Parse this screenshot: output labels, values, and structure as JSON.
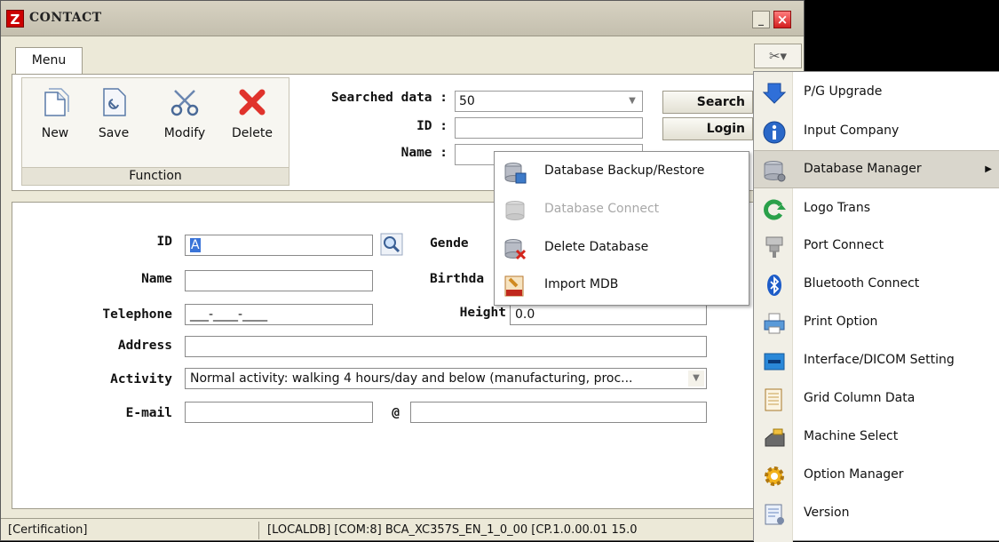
{
  "window": {
    "title": "CONTACT",
    "logo_letter": "Z",
    "minimize": "_",
    "close": "×"
  },
  "tabs": {
    "menu": "Menu",
    "tools_icon": "✂▾"
  },
  "ribbon": {
    "buttons": [
      {
        "label": "New",
        "icon": "new-document-icon"
      },
      {
        "label": "Save",
        "icon": "save-icon"
      },
      {
        "label": "Modify",
        "icon": "scissors-icon"
      },
      {
        "label": "Delete",
        "icon": "delete-x-icon"
      }
    ],
    "group_label": "Function"
  },
  "search": {
    "searched_label": "Searched data :",
    "searched_value": "50",
    "id_label": "ID :",
    "id_value": "",
    "name_label": "Name :",
    "name_value": "",
    "search_button": "Search",
    "login_button": "Login"
  },
  "form": {
    "id_label": "ID",
    "id_value": "A",
    "name_label": "Name",
    "name_value": "",
    "telephone_label": "Telephone",
    "telephone_value": "___-____-____",
    "address_label": "Address",
    "address_value": "",
    "activity_label": "Activity",
    "activity_value": "Normal activity: walking 4 hours/day and below (manufacturing, proc...",
    "email_label": "E-mail",
    "email_at": "@",
    "email_user": "",
    "email_domain": "",
    "gender_label": "Gende",
    "birthday_label": "Birthda",
    "height_label": "Height",
    "height_value": "0.0"
  },
  "status": {
    "certification": "[Certification]",
    "info": "[LOCALDB]  [COM:8]  BCA_XC357S_EN_1_0_00 [CP.1.0.00.01 15.0"
  },
  "submenu": {
    "items": [
      {
        "label": "Database Backup/Restore",
        "icon": "database-backup-icon",
        "enabled": true
      },
      {
        "label": "Database Connect",
        "icon": "database-connect-icon",
        "enabled": false
      },
      {
        "label": "Delete Database",
        "icon": "database-delete-icon",
        "enabled": true
      },
      {
        "label": "Import MDB",
        "icon": "import-mdb-icon",
        "enabled": true
      }
    ]
  },
  "dropdown": {
    "items": [
      {
        "label": "P/G Upgrade",
        "icon": "upgrade-arrow-icon"
      },
      {
        "label": "Input Company",
        "icon": "info-icon"
      },
      {
        "label": "Database Manager",
        "icon": "database-icon",
        "has_submenu": true
      },
      {
        "label": "Logo Trans",
        "icon": "logo-trans-icon"
      },
      {
        "label": "Port Connect",
        "icon": "port-connector-icon"
      },
      {
        "label": "Bluetooth Connect",
        "icon": "bluetooth-icon"
      },
      {
        "label": "Print Option",
        "icon": "printer-icon"
      },
      {
        "label": "Interface/DICOM Setting",
        "icon": "interface-icon"
      },
      {
        "label": "Grid Column Data",
        "icon": "grid-column-icon"
      },
      {
        "label": "Machine Select",
        "icon": "machine-icon"
      },
      {
        "label": "Option Manager",
        "icon": "gear-icon"
      },
      {
        "label": "Version",
        "icon": "version-icon"
      }
    ],
    "submenu_arrow": "▶"
  },
  "colors": {
    "accent_blue": "#3a74d8",
    "close_red": "#d21e1e",
    "delete_red": "#e0332c"
  }
}
